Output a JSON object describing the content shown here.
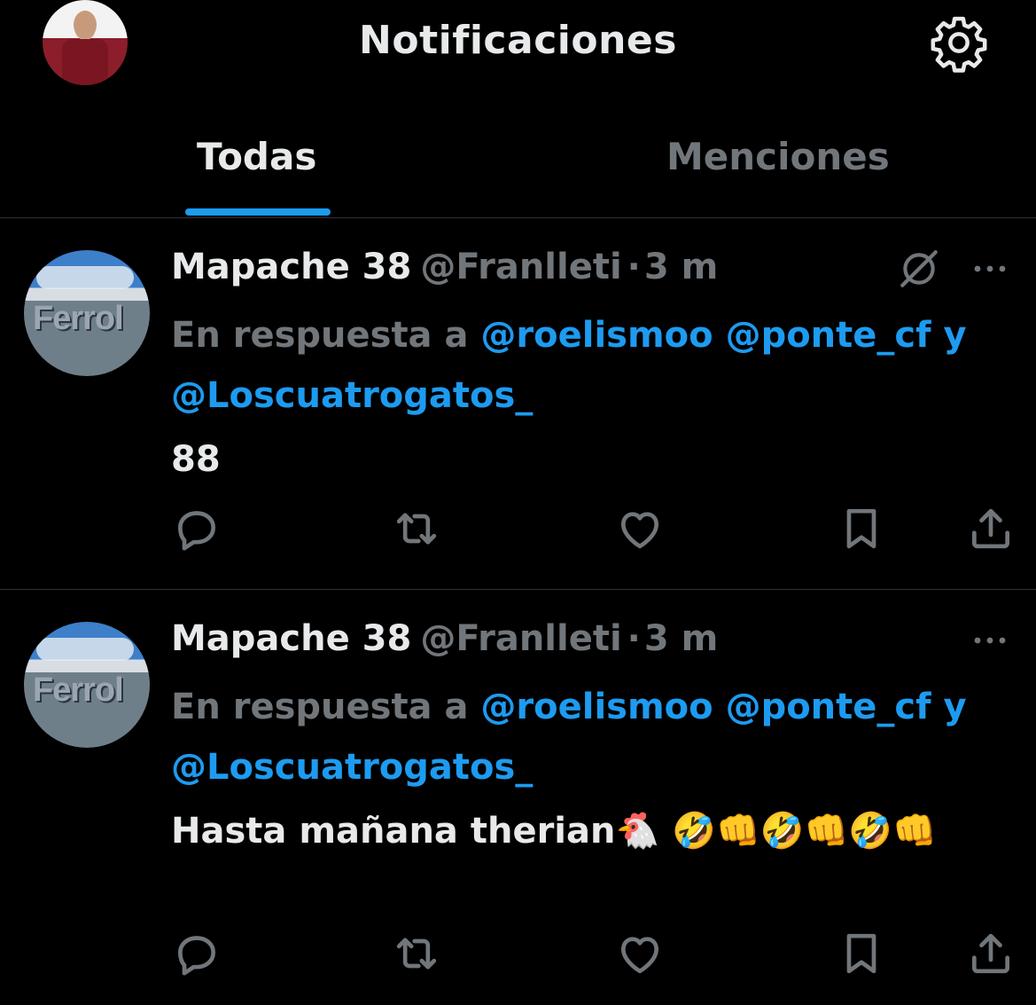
{
  "header": {
    "title": "Notificaciones",
    "avatar_icon": "profile-avatar",
    "settings_icon": "gear-icon"
  },
  "tabs": [
    {
      "label": "Todas",
      "active": true
    },
    {
      "label": "Menciones",
      "active": false
    }
  ],
  "colors": {
    "background": "#000000",
    "text": "#e7e9ea",
    "muted": "#71767b",
    "accent": "#1d9bf0",
    "divider": "#2f3336"
  },
  "tweets": [
    {
      "name": "Mapache 38",
      "handle": "@Franlleti",
      "dot": "·",
      "time": "3 m",
      "reply_prefix": "En respuesta a ",
      "mention_1": "@roelismoo",
      "mention_2": "@ponte_cf",
      "joiner": " y ",
      "mention_3": "@Loscuatrogatos_",
      "text": "88",
      "avatar_sign": "Ferrol",
      "show_grok": true
    },
    {
      "name": "Mapache 38",
      "handle": "@Franlleti",
      "dot": "·",
      "time": "3 m",
      "reply_prefix": "En respuesta a ",
      "mention_1": "@roelismoo",
      "mention_2": "@ponte_cf",
      "joiner": " y ",
      "mention_3": "@Loscuatrogatos_",
      "text": "Hasta mañana therian🐔 🤣👊🤣👊🤣👊",
      "avatar_sign": "Ferrol",
      "show_grok": false
    }
  ],
  "actions": [
    "reply-icon",
    "retweet-icon",
    "like-icon",
    "bookmark-icon",
    "share-icon"
  ]
}
